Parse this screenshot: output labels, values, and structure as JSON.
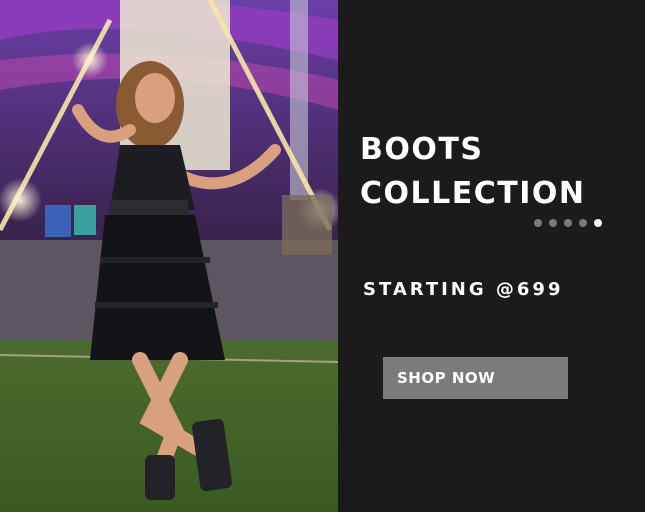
{
  "banner": {
    "heading_line1": "BOOTS",
    "heading_line2": "COLLECTION",
    "price_text": "STARTING @699",
    "cta_label": "SHOP NOW",
    "carousel": {
      "slide_count": 5,
      "active_index": 4
    }
  },
  "colors": {
    "panel_background": "#1b1b1b",
    "heading_text": "#ffffff",
    "cta_background": "#7b7b7b",
    "dot_inactive": "#7a7a7a",
    "dot_active": "#ffffff"
  }
}
